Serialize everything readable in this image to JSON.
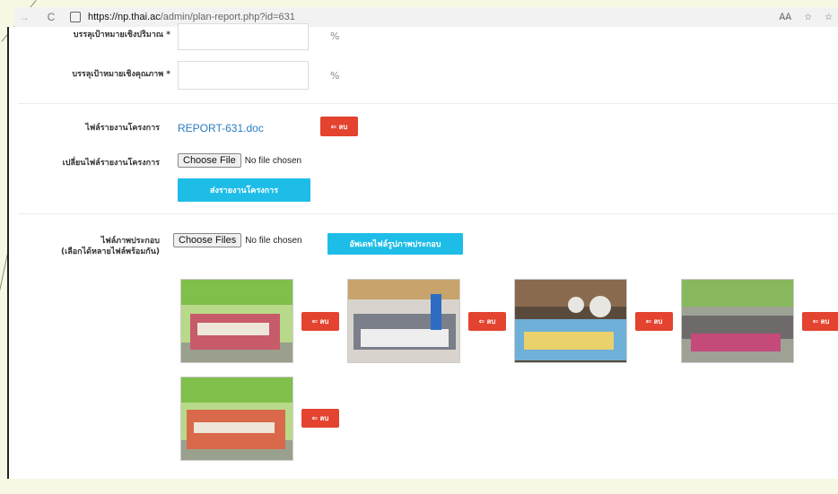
{
  "browser": {
    "url_host": "https://np.thai.ac",
    "url_path": "/admin/plan-report.php?id=631"
  },
  "form": {
    "quantity_label": "บรรลุเป้าหมายเชิงปริมาณ *",
    "quality_label": "บรรลุเป้าหมายเชิงคุณภาพ *",
    "percent_unit": "%",
    "report_file_label": "ไฟล์รายงานโครงการ",
    "report_file_name": "REPORT-631.doc",
    "delete_label": "ลบ",
    "change_file_label": "เปลี่ยนไฟล์รายงานโครงการ",
    "choose_file_btn": "Choose File",
    "no_file": "No file chosen",
    "submit_report_btn": "ส่งรายงานโครงการ",
    "images_label_line1": "ไฟล์ภาพประกอบ",
    "images_label_line2": "(เลือกได้หลายไฟล์พร้อมกัน)",
    "choose_files_btn": "Choose Files",
    "upload_images_btn": "อัพเดทไฟล์รูปภาพประกอบ"
  },
  "colors": {
    "delete": "#e3432f",
    "primary": "#1ebde8",
    "link": "#2a7cc0"
  },
  "photos_count_note": [
    "photo-1",
    "photo-2",
    "photo-3",
    "photo-4",
    "photo-5"
  ]
}
